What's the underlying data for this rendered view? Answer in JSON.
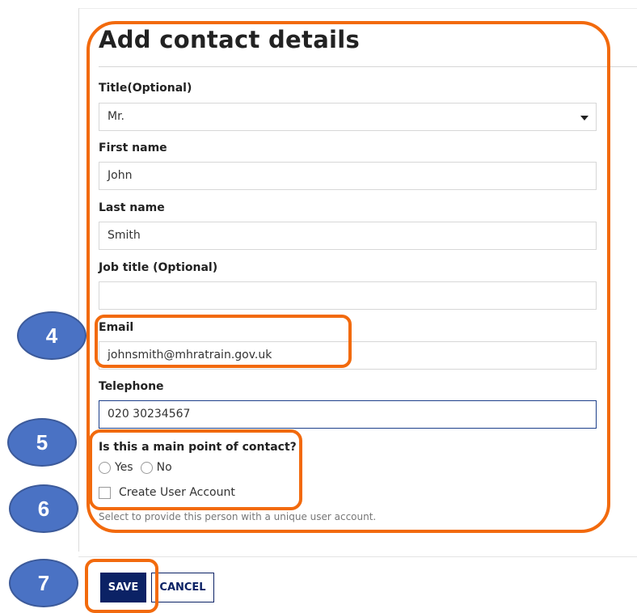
{
  "form": {
    "title": "Add contact details",
    "fields": {
      "title": {
        "label": "Title(Optional)",
        "value": "Mr."
      },
      "first_name": {
        "label": "First name",
        "value": "John"
      },
      "last_name": {
        "label": "Last name",
        "value": "Smith"
      },
      "job_title": {
        "label": "Job title (Optional)",
        "value": ""
      },
      "email": {
        "label": "Email",
        "value": "johnsmith@mhratrain.gov.uk"
      },
      "telephone": {
        "label": "Telephone",
        "value": "020 30234567"
      }
    },
    "main_contact": {
      "label": "Is this a main point of contact?",
      "options": [
        "Yes",
        "No"
      ]
    },
    "user_account": {
      "label": "Create User Account",
      "help": "Select to provide this person with a unique user account."
    },
    "buttons": {
      "save": "SAVE",
      "cancel": "CANCEL"
    }
  },
  "annotations": {
    "steps": [
      "4",
      "5",
      "6",
      "7"
    ],
    "callout_color": "#f26a0d",
    "badge_color": "#4a72c4"
  },
  "colors": {
    "primary": "#0b2265",
    "focus_border": "#1d3f8a"
  }
}
